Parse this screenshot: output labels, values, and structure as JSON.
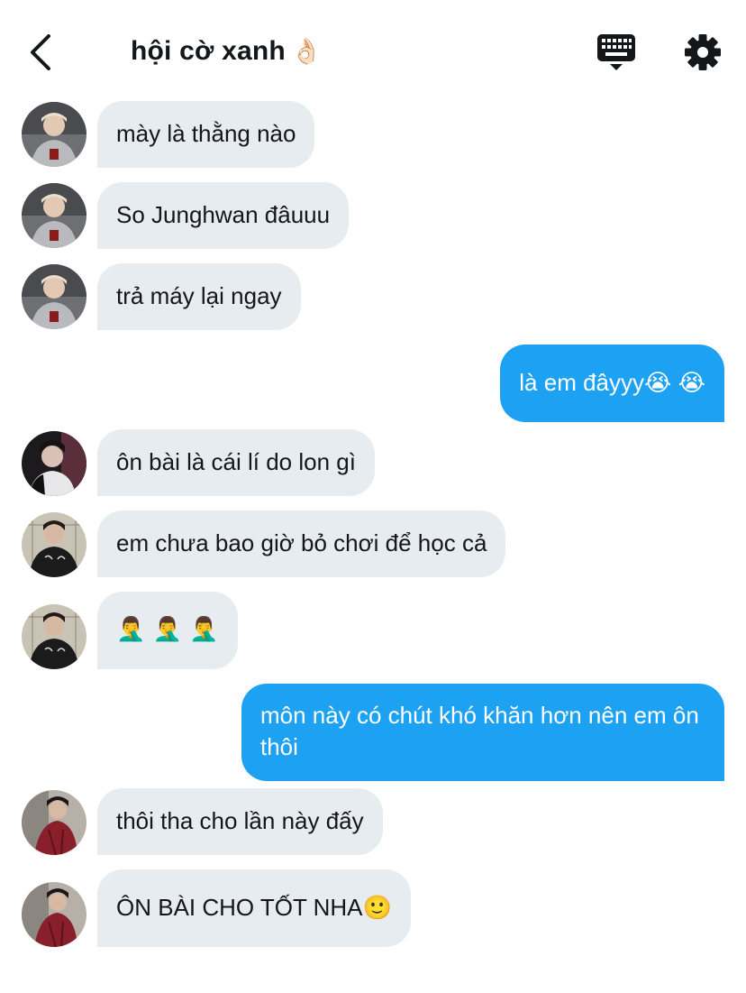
{
  "header": {
    "title": "hội cờ xanh",
    "title_emoji": "👌🏻",
    "back_icon": "chevron-left-icon",
    "keyboard_icon": "keyboard-icon",
    "settings_icon": "gear-icon"
  },
  "colors": {
    "incoming_bubble": "#e6ecf0",
    "outgoing_bubble": "#1da1f2",
    "text": "#14171a"
  },
  "messages": [
    {
      "direction": "in",
      "avatar": "avatar-1",
      "text": "mày là thằng nào"
    },
    {
      "direction": "in",
      "avatar": "avatar-1",
      "text": "So Junghwan đâuuu"
    },
    {
      "direction": "in",
      "avatar": "avatar-1",
      "text": "trả máy lại ngay"
    },
    {
      "direction": "out",
      "text": "là em đâyyy😭 😭"
    },
    {
      "direction": "in",
      "avatar": "avatar-2",
      "text": "ôn bài là cái lí do lon gì"
    },
    {
      "direction": "in",
      "avatar": "avatar-3",
      "text": "em chưa bao giờ bỏ chơi để học cả"
    },
    {
      "direction": "in",
      "avatar": "avatar-3",
      "text": "🤦‍♂️ 🤦‍♂️ 🤦‍♂️"
    },
    {
      "direction": "out",
      "text": "môn này có chút khó khăn hơn nên em ôn thôi"
    },
    {
      "direction": "in",
      "avatar": "avatar-4",
      "text": "thôi tha cho lần này đấy"
    },
    {
      "direction": "in",
      "avatar": "avatar-4",
      "text": "ÔN BÀI CHO TỐT NHA🙂"
    }
  ]
}
